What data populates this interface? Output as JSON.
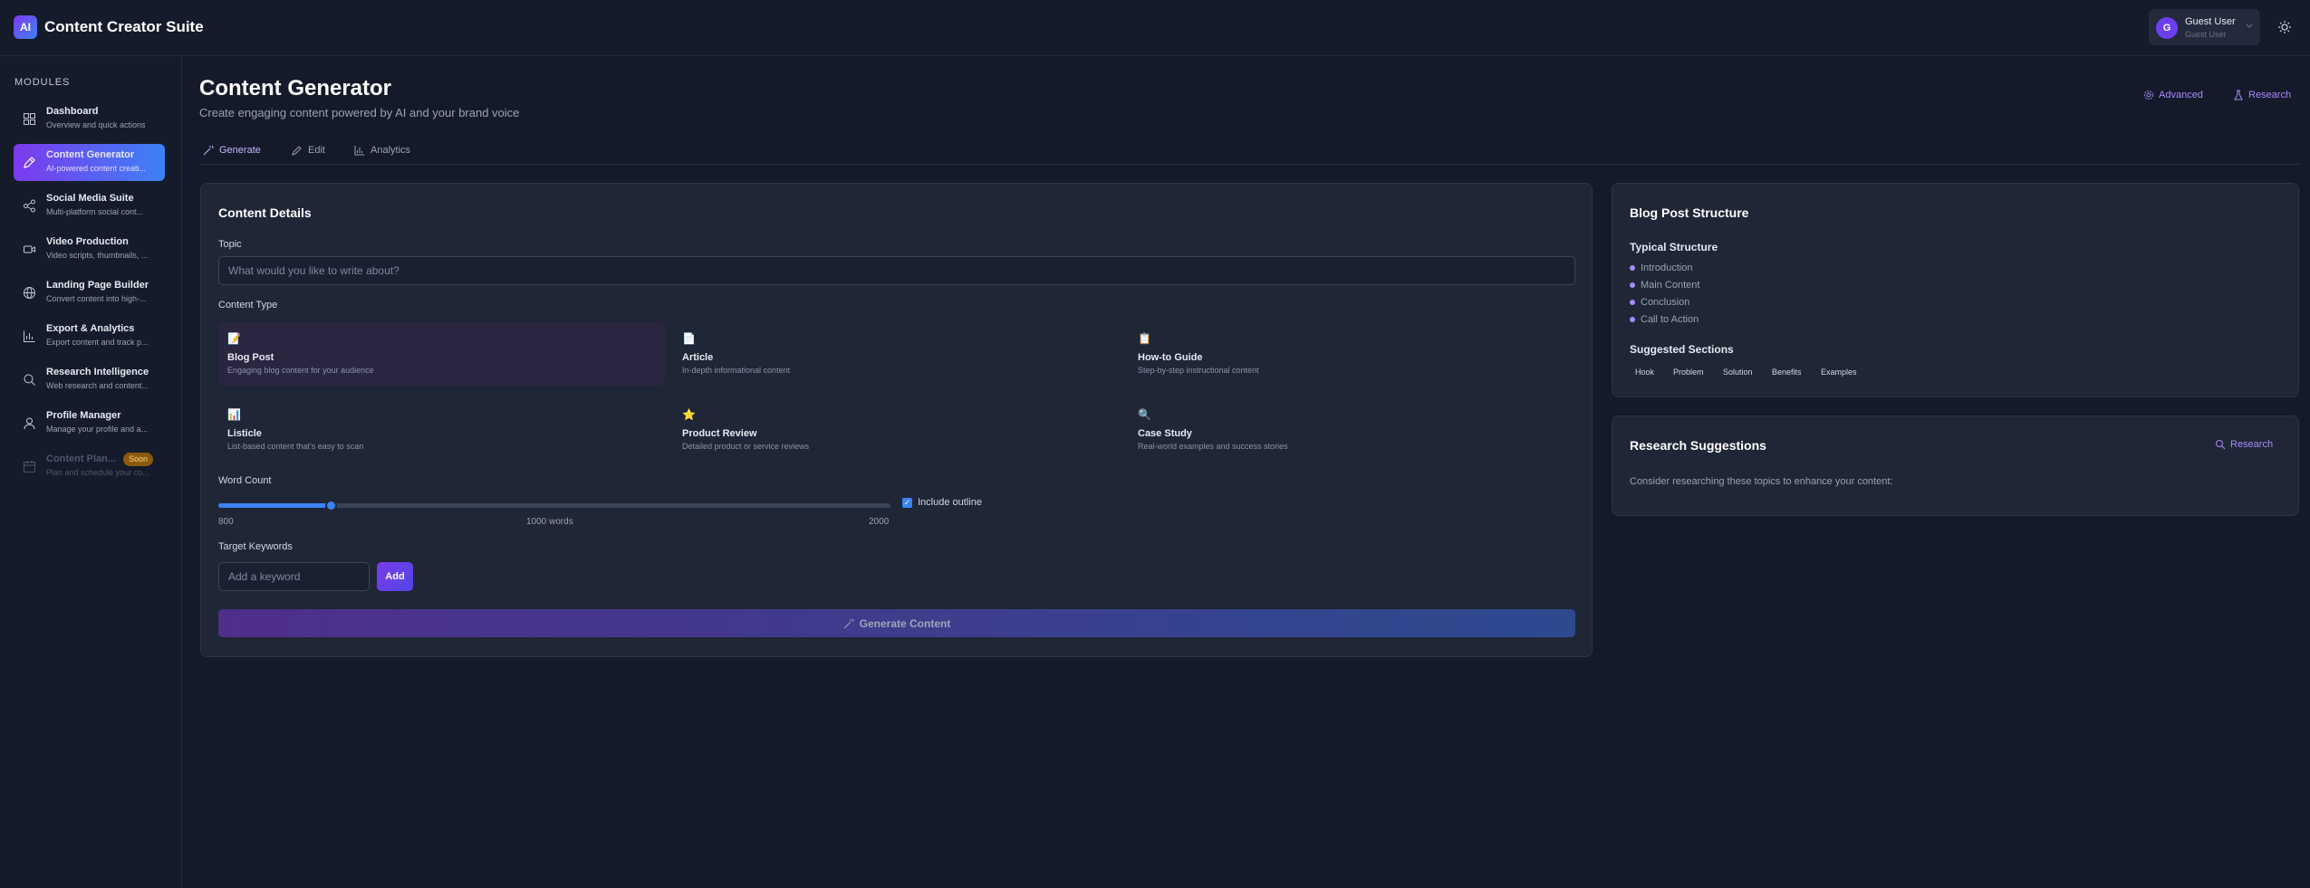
{
  "app": {
    "logo": "AI",
    "title": "Content Creator Suite"
  },
  "user": {
    "initial": "G",
    "name": "Guest User",
    "role": "Guest User"
  },
  "sidebar": {
    "section_label": "MODULES",
    "items": [
      {
        "title": "Dashboard",
        "desc": "Overview and quick actions",
        "icon": "grid-icon"
      },
      {
        "title": "Content Generator",
        "desc": "AI-powered content creati...",
        "icon": "pen-icon",
        "active": true
      },
      {
        "title": "Social Media Suite",
        "desc": "Multi-platform social cont...",
        "icon": "share-icon"
      },
      {
        "title": "Video Production",
        "desc": "Video scripts, thumbnails, ...",
        "icon": "video-icon"
      },
      {
        "title": "Landing Page Builder",
        "desc": "Convert content into high-...",
        "icon": "globe-icon"
      },
      {
        "title": "Export & Analytics",
        "desc": "Export content and track p...",
        "icon": "bar-chart-icon"
      },
      {
        "title": "Research Intelligence",
        "desc": "Web research and content...",
        "icon": "search-icon"
      },
      {
        "title": "Profile Manager",
        "desc": "Manage your profile and a...",
        "icon": "user-icon"
      },
      {
        "title": "Content Plan...",
        "desc": "Plan and schedule your co...",
        "icon": "calendar-icon",
        "disabled": true,
        "badge": "Soon"
      }
    ]
  },
  "page": {
    "title": "Content Generator",
    "subtitle": "Create engaging content powered by AI and your brand voice",
    "advanced_label": "Advanced",
    "research_label": "Research"
  },
  "tabs": [
    {
      "label": "Generate",
      "active": true
    },
    {
      "label": "Edit"
    },
    {
      "label": "Analytics"
    }
  ],
  "content_details": {
    "title": "Content Details",
    "topic_label": "Topic",
    "topic_placeholder": "What would you like to write about?",
    "content_type_label": "Content Type",
    "types": [
      {
        "emoji": "📝",
        "name": "Blog Post",
        "desc": "Engaging blog content for your audience",
        "selected": true
      },
      {
        "emoji": "📄",
        "name": "Article",
        "desc": "In-depth informational content"
      },
      {
        "emoji": "📋",
        "name": "How-to Guide",
        "desc": "Step-by-step instructional content"
      },
      {
        "emoji": "📊",
        "name": "Listicle",
        "desc": "List-based content that's easy to scan"
      },
      {
        "emoji": "⭐",
        "name": "Product Review",
        "desc": "Detailed product or service reviews"
      },
      {
        "emoji": "🔍",
        "name": "Case Study",
        "desc": "Real-world examples and success stories"
      }
    ],
    "word_count_label": "Word Count",
    "word_min": "800",
    "word_current": "1000 words",
    "word_max": "2000",
    "word_value": 1000,
    "word_range": [
      800,
      2000
    ],
    "include_outline_label": "Include outline",
    "include_outline": true,
    "keywords_label": "Target Keywords",
    "keyword_placeholder": "Add a keyword",
    "add_label": "Add",
    "generate_label": "Generate Content"
  },
  "structure": {
    "title": "Blog Post Structure",
    "typical_label": "Typical Structure",
    "typical": [
      "Introduction",
      "Main Content",
      "Conclusion",
      "Call to Action"
    ],
    "suggested_label": "Suggested Sections",
    "suggested": [
      "Hook",
      "Problem",
      "Solution",
      "Benefits",
      "Examples"
    ]
  },
  "research": {
    "title": "Research Suggestions",
    "button_label": "Research",
    "note": "Consider researching these topics to enhance your content:"
  },
  "colors": {
    "accent": "#7c3aed",
    "accent2": "#3b82f6",
    "background": "#141a2a",
    "card": "#1f2636"
  }
}
